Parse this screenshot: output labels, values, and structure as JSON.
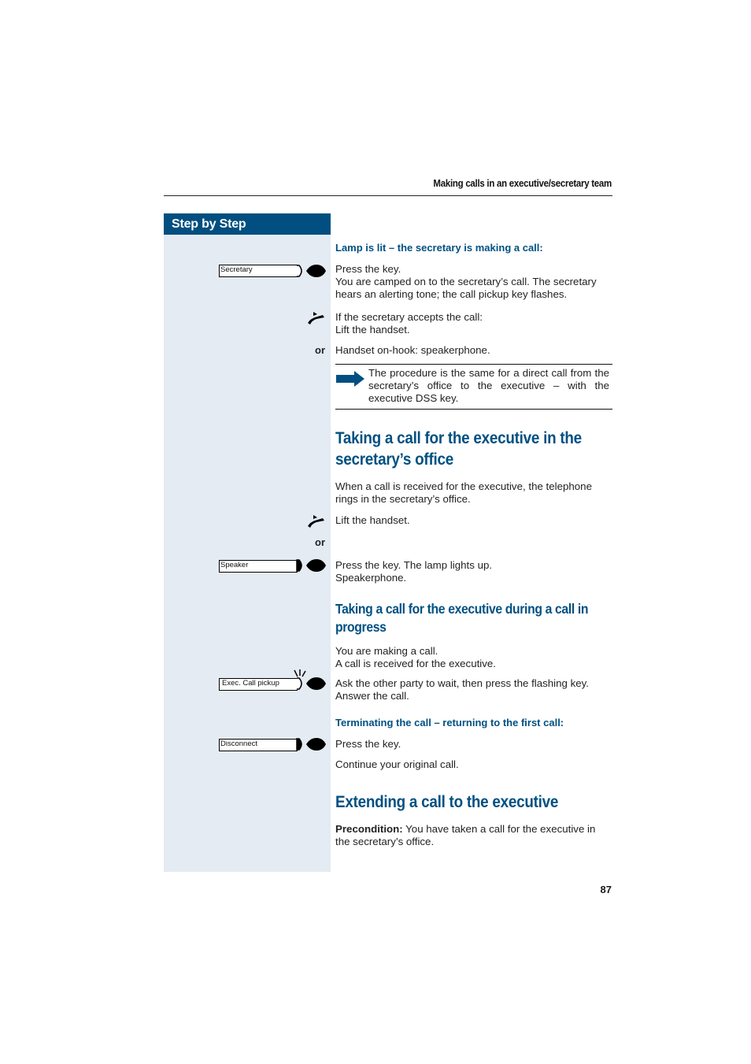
{
  "running_header": "Making calls in an executive/secretary team",
  "sidebar": {
    "title": "Step by Step"
  },
  "keys": {
    "secretary": "Secretary",
    "speaker": "Speaker",
    "exec_call_pickup": "Exec. Call pickup",
    "disconnect": "Disconnect"
  },
  "or_label": "or",
  "section1": {
    "subheading": "Lamp is lit – the secretary is making a call:",
    "step1_line1": "Press the key.",
    "step1_line2": "You are camped on to the secretary’s call. The secretary hears an alerting tone; the call pickup key flashes.",
    "step2_line1": "If the secretary accepts the call:",
    "step2_line2": "Lift the handset.",
    "step3": "Handset on-hook: speakerphone.",
    "note": "The procedure is the same for a direct call from the secretary’s office to the executive – with the executive DSS key."
  },
  "section2": {
    "heading": "Taking a call for the executive in the secretary’s office",
    "intro": "When a call is received for the executive, the telephone rings in the secretary’s office.",
    "step1": "Lift the handset.",
    "step2_line1": "Press the key. The lamp lights up.",
    "step2_line2": "Speakerphone."
  },
  "section3": {
    "heading": "Taking a call for the executive during a call in progress",
    "intro_line1": "You are making a call.",
    "intro_line2": "A call is received for the executive.",
    "step1_line1": "Ask the other party to wait, then press the flashing key.",
    "step1_line2": "Answer the call.",
    "subheading": "Terminating the call – returning to the first call:",
    "step2": "Press the key.",
    "step3": "Continue your original call."
  },
  "section4": {
    "heading": "Extending a call to the executive",
    "precondition_label": "Precondition:",
    "precondition_text": " You have taken a call for the executive in the secretary’s office."
  },
  "page_number": "87",
  "colors": {
    "brand_blue": "#004f80",
    "heading_blue": "#005082",
    "sidebar_bg": "#e4ebf3"
  }
}
